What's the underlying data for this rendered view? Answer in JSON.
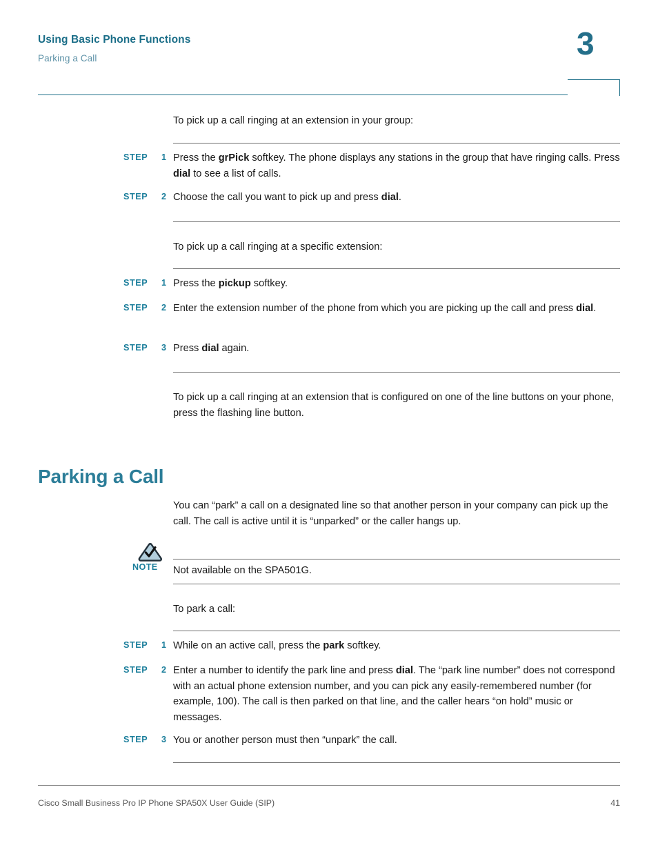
{
  "header": {
    "title": "Using Basic Phone Functions",
    "subtitle": "Parking a Call",
    "chapter_number": "3",
    "accent_color": "#1b6e88"
  },
  "sections": {
    "intro_group_para": "To pick up a call ringing at an extension in your group:",
    "specific_ext_para": "To pick up a call ringing at a specific extension:",
    "line_button_para": "To pick up a call ringing at an extension that is configured on one of the line buttons on your phone, press the flashing line button.",
    "heading": "Parking a Call",
    "parking_intro_para": "You can “park” a call on a designated line so that another person in your company can pick up the call. The call is active until it is “unparked” or the caller hangs up.",
    "to_park_para": "To park a call:"
  },
  "step_label": "STEP",
  "steps_group": [
    {
      "num": "1",
      "html": "Press the <b>grPick</b> softkey. The phone displays any stations in the group that have ringing calls. Press <b>dial</b> to see a list of calls."
    },
    {
      "num": "2",
      "html": "Choose the call you want to pick up and press <b>dial</b>."
    }
  ],
  "steps_specific": [
    {
      "num": "1",
      "html": "Press the <b>pickup</b> softkey."
    },
    {
      "num": "2",
      "html": "Enter the extension number of the phone from which you are picking up the call and press <b>dial</b>."
    },
    {
      "num": "3",
      "html": "Press <b>dial</b> again."
    }
  ],
  "steps_park": [
    {
      "num": "1",
      "html": "While on an active call, press the <b>park</b> softkey."
    },
    {
      "num": "2",
      "html": "Enter a number to identify the park line and press <b>dial</b>. The “park line number” does not correspond with an actual phone extension number, and you can pick any easily-remembered number (for example, 100). The call is then parked on that line, and the caller hears “on hold” music or messages."
    },
    {
      "num": "3",
      "html": "You or another person must then “unpark” the call."
    }
  ],
  "note": {
    "label": "NOTE",
    "text": "Not available on the SPA501G.",
    "icon": "note-triangle-check-icon"
  },
  "footer": {
    "text": "Cisco Small Business Pro IP Phone SPA50X User Guide (SIP)",
    "page_number": "41"
  }
}
